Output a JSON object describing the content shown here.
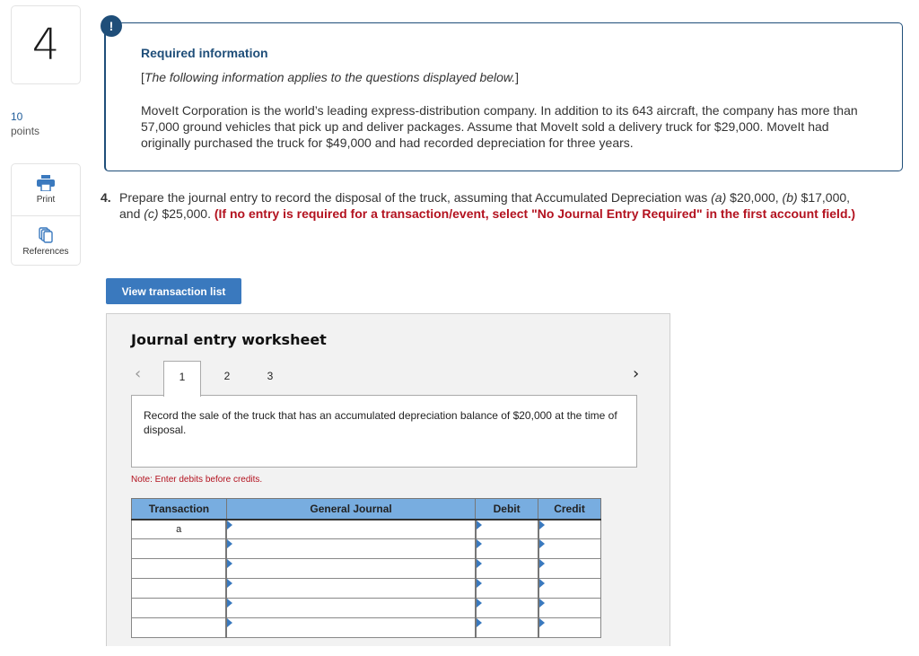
{
  "question": {
    "number": "4",
    "points_value": "10",
    "points_label": "points"
  },
  "tools": {
    "print_label": "Print",
    "print_icon": "printer-icon",
    "references_label": "References",
    "references_icon": "documents-icon"
  },
  "required_info": {
    "badge": "!",
    "title": "Required information",
    "subtitle_open": "[",
    "subtitle": "The following information applies to the questions displayed below.",
    "subtitle_close": "]",
    "body": "MoveIt Corporation is the world’s leading express-distribution company. In addition to its 643 aircraft, the company has more than 57,000 ground vehicles that pick up and deliver packages. Assume that MoveIt sold a delivery truck for $29,000. MoveIt had originally purchased the truck for $49,000 and had recorded depreciation for three years."
  },
  "prompt": {
    "number": "4.",
    "text_1": "Prepare the journal entry to record the disposal of the truck, assuming that Accumulated Depreciation was ",
    "a_label": "(a)",
    "a_value": " $20,000, ",
    "b_label": "(b)",
    "b_value": " $17,000, and ",
    "c_label": "(c)",
    "c_value": " $25,000. ",
    "instruction": "(If no entry is required for a transaction/event, select \"No Journal Entry Required\" in the first account field.)"
  },
  "view_transaction_list_label": "View transaction list",
  "worksheet": {
    "title": "Journal entry worksheet",
    "prev_icon": "‹",
    "next_icon": "›",
    "tabs": [
      "1",
      "2",
      "3"
    ],
    "active_tab": "1",
    "instruction": "Record the sale of the truck that has an accumulated depreciation balance of $20,000 at the time of disposal.",
    "note": "Note: Enter debits before credits.",
    "columns": [
      "Transaction",
      "General Journal",
      "Debit",
      "Credit"
    ],
    "rows": [
      {
        "transaction": "a",
        "account": "",
        "debit": "",
        "credit": ""
      },
      {
        "transaction": "",
        "account": "",
        "debit": "",
        "credit": ""
      },
      {
        "transaction": "",
        "account": "",
        "debit": "",
        "credit": ""
      },
      {
        "transaction": "",
        "account": "",
        "debit": "",
        "credit": ""
      },
      {
        "transaction": "",
        "account": "",
        "debit": "",
        "credit": ""
      },
      {
        "transaction": "",
        "account": "",
        "debit": "",
        "credit": ""
      }
    ]
  }
}
